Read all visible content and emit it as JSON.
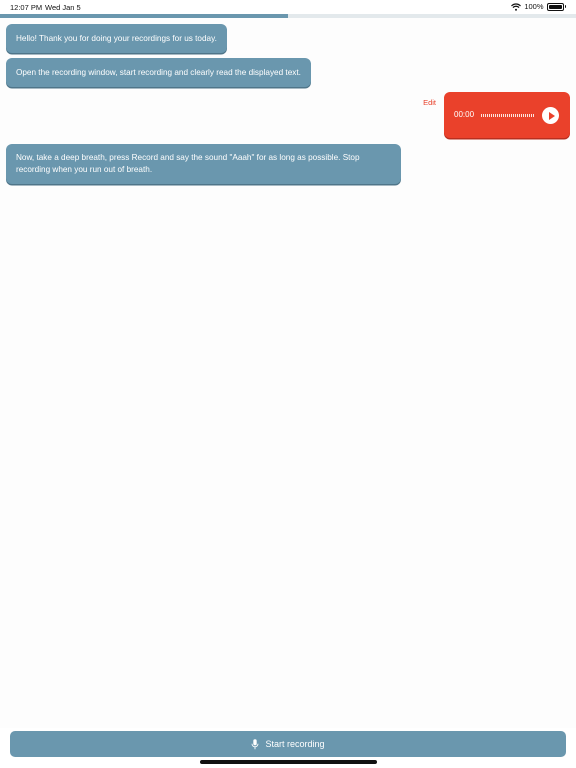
{
  "status_bar": {
    "time": "12:07 PM",
    "date": "Wed Jan 5",
    "battery": "100%"
  },
  "progress": {
    "fraction": 0.5
  },
  "messages": [
    {
      "text": "Hello! Thank you for doing your recordings for us today."
    },
    {
      "text": "Open the recording window, start recording and clearly read the displayed text."
    },
    {
      "text": "Now, take a deep breath, press Record and say the sound \"Aaah\" for as long as possible. Stop recording when you run out of breath."
    }
  ],
  "audio_message": {
    "edit_label": "Edit",
    "duration": "00:00"
  },
  "record_button": {
    "label": "Start recording"
  },
  "colors": {
    "accent": "#6a97ae",
    "recording": "#ea412b"
  }
}
